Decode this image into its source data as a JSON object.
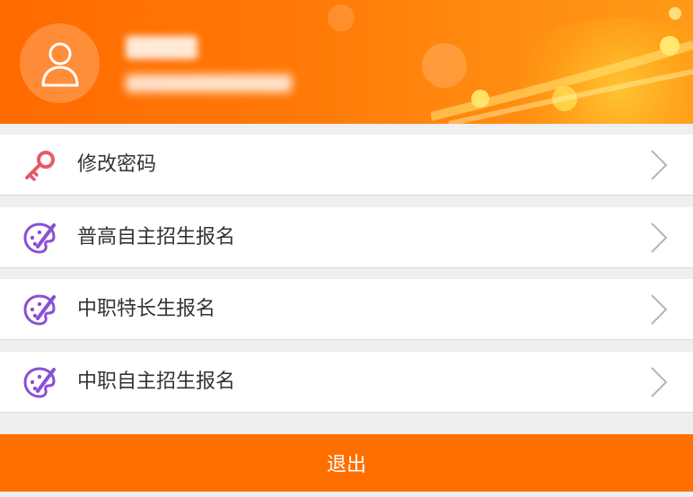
{
  "header": {
    "background_color": "#ff6a00",
    "avatar_icon": "user-icon"
  },
  "menu": {
    "items": [
      {
        "label": "修改密码",
        "icon": "key-icon",
        "icon_color": "#e45a6b"
      },
      {
        "label": "普高自主招生报名",
        "icon": "palette-icon",
        "icon_color": "#8a4fd6"
      },
      {
        "label": "中职特长生报名",
        "icon": "palette-icon",
        "icon_color": "#8a4fd6"
      },
      {
        "label": "中职自主招生报名",
        "icon": "palette-icon",
        "icon_color": "#8a4fd6"
      }
    ]
  },
  "logout": {
    "label": "退出",
    "color": "#ff6f00"
  }
}
